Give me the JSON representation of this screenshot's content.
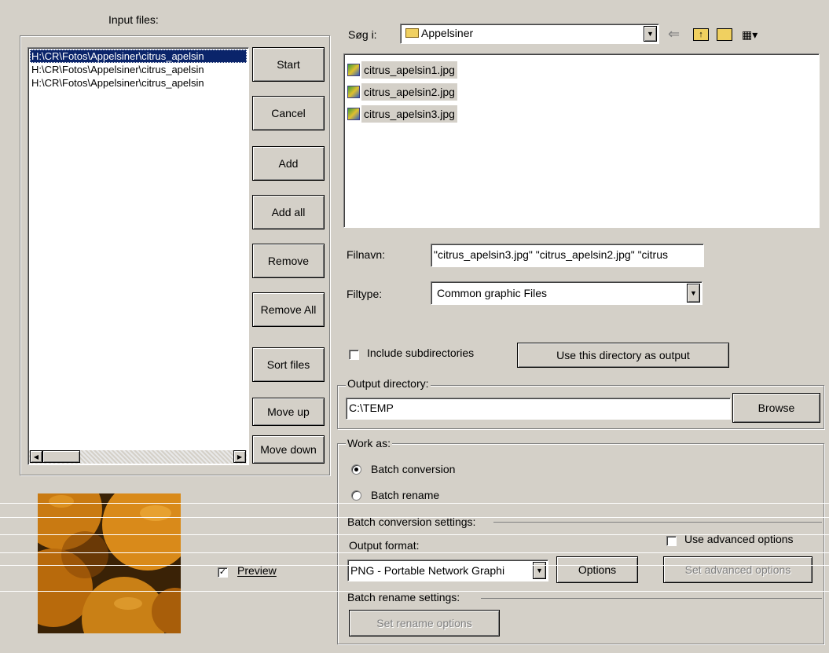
{
  "input_panel": {
    "label": "Input files:",
    "files": [
      "H:\\CR\\Fotos\\Appelsiner\\citrus_apelsin",
      "H:\\CR\\Fotos\\Appelsiner\\citrus_apelsin",
      "H:\\CR\\Fotos\\Appelsiner\\citrus_apelsin"
    ]
  },
  "buttons": {
    "start": "Start",
    "cancel": "Cancel",
    "add": "Add",
    "add_all": "Add all",
    "remove": "Remove",
    "remove_all": "Remove All",
    "sort_files": "Sort files",
    "move_up": "Move up",
    "move_down": "Move down"
  },
  "browser": {
    "look_in_label": "Søg i:",
    "look_in_value": "Appelsiner",
    "files": [
      "citrus_apelsin1.jpg",
      "citrus_apelsin2.jpg",
      "citrus_apelsin3.jpg"
    ],
    "filename_label": "Filnavn:",
    "filename_value": "\"citrus_apelsin3.jpg\" \"citrus_apelsin2.jpg\" \"citrus",
    "filetype_label": "Filtype:",
    "filetype_value": "Common graphic Files",
    "include_subdirs_label": "Include subdirectories",
    "include_subdirs_checked": false,
    "use_dir_button": "Use this directory as output"
  },
  "output": {
    "group_title": "Output directory:",
    "path": "C:\\TEMP",
    "browse_button": "Browse"
  },
  "work_as": {
    "group_title": "Work as:",
    "batch_conversion": "Batch conversion",
    "batch_rename": "Batch rename",
    "selected": "batch_conversion"
  },
  "conversion": {
    "group_title": "Batch conversion settings:",
    "output_format_label": "Output format:",
    "output_format_value": "PNG - Portable Network Graphi",
    "options_button": "Options",
    "use_advanced_label": "Use advanced options",
    "use_advanced_checked": false,
    "set_advanced_button": "Set advanced options"
  },
  "rename": {
    "group_title": "Batch rename settings:",
    "set_rename_button": "Set rename options"
  },
  "preview": {
    "label": "Preview",
    "checked": true
  }
}
